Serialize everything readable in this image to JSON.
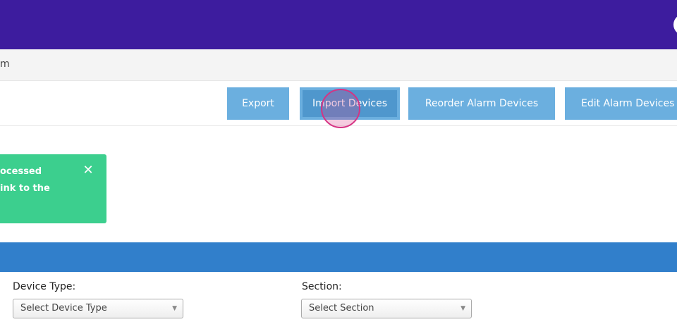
{
  "breadcrumb": {
    "text": "m"
  },
  "toolbar": {
    "export_label": "Export",
    "import_label": "Import Devices",
    "reorder_label": "Reorder Alarm Devices",
    "edit_label": "Edit Alarm Devices"
  },
  "toast": {
    "line1": "ocessed",
    "line2": "ink to the",
    "close_glyph": "✕"
  },
  "filters": {
    "device_type": {
      "label": "Device Type:",
      "selected": "Select Device Type"
    },
    "section": {
      "label": "Section:",
      "selected": "Select Section"
    }
  },
  "colors": {
    "topbar": "#3d1c9e",
    "button": "#6bafdf",
    "button_active": "#4f97cd",
    "toast": "#3ccf8e",
    "section_band": "#317fcb"
  }
}
